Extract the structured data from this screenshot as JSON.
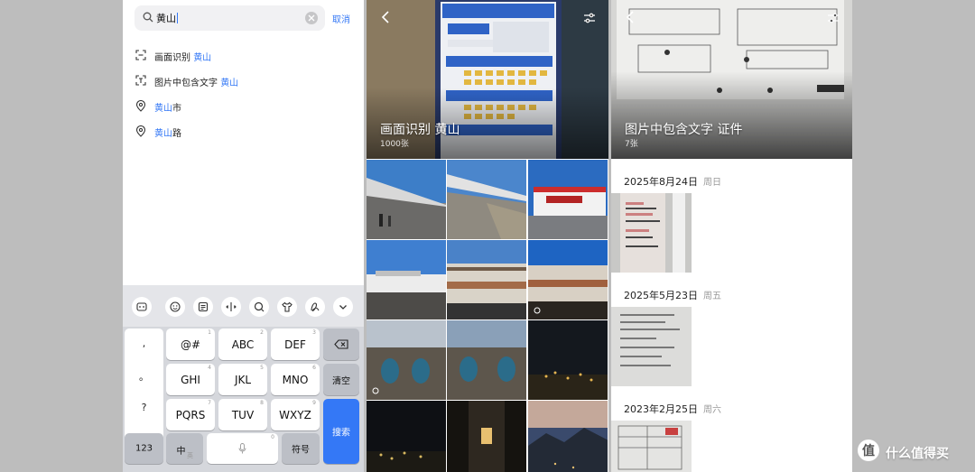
{
  "search": {
    "query": "黄山",
    "cancel_label": "取消",
    "suggestions": [
      {
        "icon": "scan-icon",
        "prefix": "画面识别 ",
        "highlight": "黄山",
        "suffix": ""
      },
      {
        "icon": "text-scan-icon",
        "prefix": "图片中包含文字 ",
        "highlight": "黄山",
        "suffix": ""
      },
      {
        "icon": "location-pin-icon",
        "prefix": "",
        "highlight": "黄山",
        "suffix": "市"
      },
      {
        "icon": "location-pin-icon",
        "prefix": "",
        "highlight": "黄山",
        "suffix": "路"
      }
    ]
  },
  "keyboard": {
    "toolbar": [
      "ai-icon",
      "emoji-icon",
      "clipboard-icon",
      "cursor-move-icon",
      "search-icon",
      "skin-icon",
      "handwriting-icon",
      "collapse-icon"
    ],
    "punct": [
      ",",
      "。",
      "?",
      "!"
    ],
    "rows": [
      [
        {
          "label": "@#",
          "sub": "1"
        },
        {
          "label": "ABC",
          "sub": "2"
        },
        {
          "label": "DEF",
          "sub": "3"
        }
      ],
      [
        {
          "label": "GHI",
          "sub": "4"
        },
        {
          "label": "JKL",
          "sub": "5"
        },
        {
          "label": "MNO",
          "sub": "6"
        }
      ],
      [
        {
          "label": "PQRS",
          "sub": "7"
        },
        {
          "label": "TUV",
          "sub": "8"
        },
        {
          "label": "WXYZ",
          "sub": "9"
        }
      ]
    ],
    "clear_label": "清空",
    "search_label": "搜索",
    "num_label": "123",
    "lang_label": "中",
    "lang_sub": "英",
    "space_sub": "0",
    "symbol_label": "符号"
  },
  "album_scene": {
    "title": "画面识别 黄山",
    "count": "1000张"
  },
  "album_text": {
    "title": "图片中包含文字 证件",
    "count": "7张",
    "groups": [
      {
        "date": "2025年8月24日",
        "weekday": "周日"
      },
      {
        "date": "2025年5月23日",
        "weekday": "周五"
      },
      {
        "date": "2023年2月25日",
        "weekday": "周六"
      }
    ]
  },
  "watermark": "什么值得买",
  "colors": {
    "accent": "#3478f6"
  }
}
